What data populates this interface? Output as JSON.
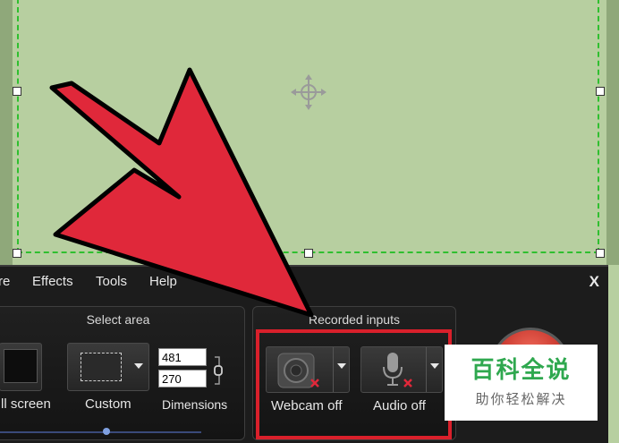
{
  "menu": {
    "items": [
      "re",
      "Effects",
      "Tools",
      "Help"
    ],
    "close": "X"
  },
  "select_area": {
    "title": "Select area",
    "full_screen_label": "ll screen",
    "custom_label": "Custom",
    "dimensions_label": "Dimensions",
    "width": "481",
    "height": "270"
  },
  "recorded_inputs": {
    "title": "Recorded inputs",
    "webcam_label": "Webcam off",
    "audio_label": "Audio off"
  },
  "watermark": {
    "title": "百科全说",
    "subtitle": "助你轻松解决"
  },
  "colors": {
    "capture_bg": "#b7cfa0",
    "selection_border": "#2fbf2f",
    "toolbar_bg": "#1c1c1c",
    "highlight": "#d9202b",
    "arrow": "#e0283a",
    "watermark_green": "#2fa84f"
  },
  "icons": [
    "move-cross-icon",
    "webcam-icon",
    "microphone-icon",
    "disabled-x-icon",
    "dropdown-arrow-icon",
    "link-chain-icon",
    "big-pointer-arrow"
  ]
}
